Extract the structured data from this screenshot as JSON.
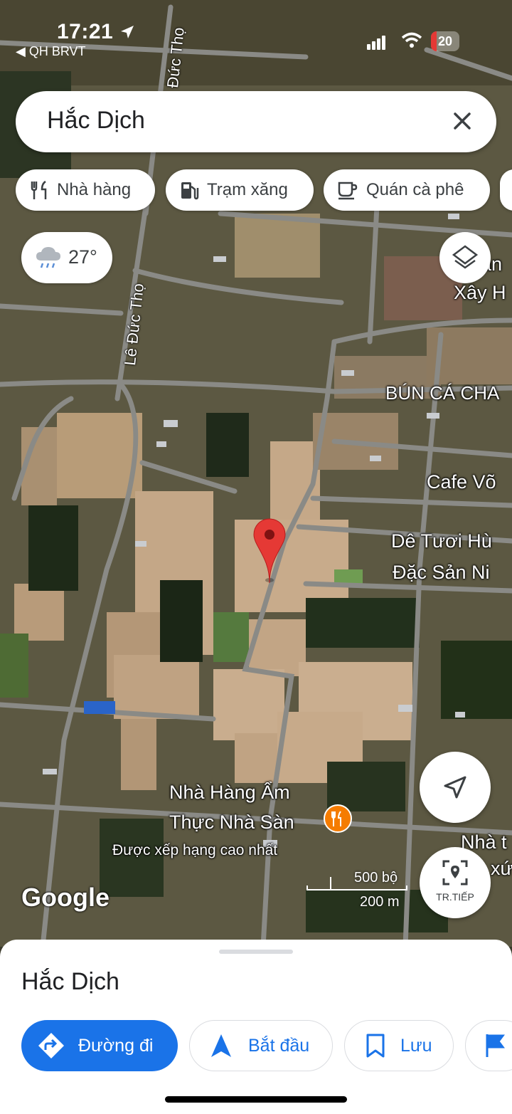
{
  "status_bar": {
    "time": "17:21",
    "back_label": "◀ QH BRVT",
    "battery": "20"
  },
  "search": {
    "query": "Hắc Dịch"
  },
  "filter_chips": [
    {
      "label": "Nhà hàng",
      "icon": "restaurant-icon"
    },
    {
      "label": "Trạm xăng",
      "icon": "gas-station-icon"
    },
    {
      "label": "Quán cà phê",
      "icon": "coffee-icon"
    }
  ],
  "weather": {
    "temp": "27°",
    "icon": "rain-cloud-icon"
  },
  "map": {
    "labels": {
      "xay": "Xây H",
      "an": "án",
      "bun": "BÚN CÁ CHA",
      "cafe": "Cafe Võ",
      "de1": "Dê Tươi Hù",
      "de2": "Đặc Sản Ni",
      "nha1": "Nhà t",
      "nha2": "xứ",
      "rest1": "Nhà Hàng Ẩm",
      "rest2": "Thực Nhà Sàn",
      "rest_sub": "Được xếp hạng cao nhất"
    },
    "roads": {
      "top": "Đức Thọ",
      "left": "Lê Đức Thọ"
    },
    "attribution": "Google",
    "scale": {
      "imperial": "500 bộ",
      "metric": "200 m"
    }
  },
  "controls": {
    "navigate_label": "TR.TIẾP"
  },
  "sheet": {
    "title": "Hắc Dịch",
    "actions": [
      {
        "label": "Đường đi"
      },
      {
        "label": "Bắt đầu"
      },
      {
        "label": "Lưu"
      }
    ]
  },
  "colors": {
    "accent": "#1a73e8",
    "pin": "#e53935",
    "restaurant": "#f57c00"
  }
}
